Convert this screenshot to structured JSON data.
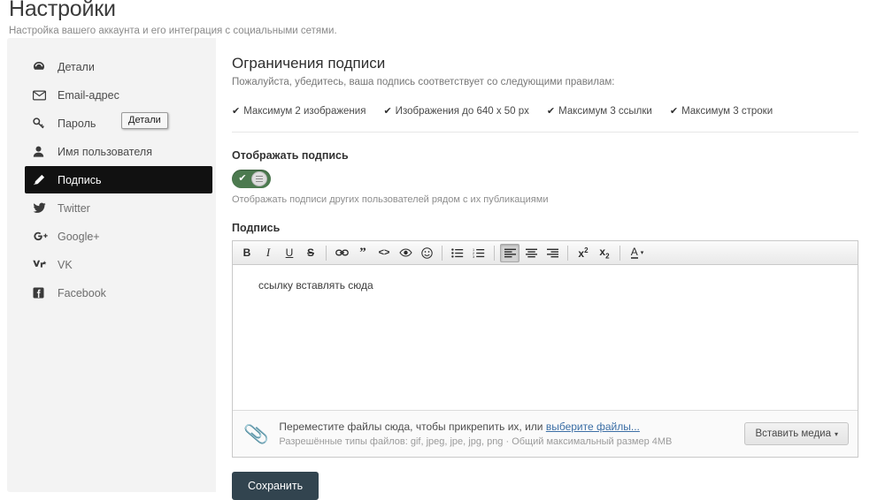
{
  "header": {
    "title": "Настройки",
    "subtitle": "Настройка вашего аккаунта и его интеграция с социальными сетями."
  },
  "tooltip": {
    "text": "Детали"
  },
  "sidebar": {
    "items": [
      {
        "label": "Детали",
        "icon": "dashboard-icon",
        "active": false
      },
      {
        "label": "Email-адрес",
        "icon": "envelope-icon",
        "active": false
      },
      {
        "label": "Пароль",
        "icon": "key-icon",
        "active": false
      },
      {
        "label": "Имя пользователя",
        "icon": "user-icon",
        "active": false
      },
      {
        "label": "Подпись",
        "icon": "pencil-icon",
        "active": true
      },
      {
        "label": "Twitter",
        "icon": "twitter-icon",
        "active": false
      },
      {
        "label": "Google+",
        "icon": "google-plus-icon",
        "active": false
      },
      {
        "label": "VK",
        "icon": "vk-icon",
        "active": false
      },
      {
        "label": "Facebook",
        "icon": "facebook-icon",
        "active": false
      }
    ]
  },
  "main": {
    "limits_title": "Ограничения подписи",
    "limits_subtitle": "Пожалуйста, убедитесь, ваша подпись соответствует со следующими правилам:",
    "rules": [
      "Максимум 2 изображения",
      "Изображения до 640 x 50 px",
      "Максимум 3 ссылки",
      "Максимум 3 строки"
    ],
    "tick_glyph": "✔",
    "toggle_label": "Отображать подпись",
    "toggle_hint": "Отображать подписи других пользователей рядом с их публикациями",
    "toggle_state": "on",
    "signature_label": "Подпись",
    "signature_value": "ссылку вставлять сюда",
    "toolbar": [
      {
        "name": "bold-icon",
        "title": "B",
        "pressed": false
      },
      {
        "name": "italic-icon",
        "title": "I",
        "pressed": false
      },
      {
        "name": "underline-icon",
        "title": "U",
        "pressed": false
      },
      {
        "name": "strikethrough-icon",
        "title": "S",
        "pressed": false
      },
      {
        "name": "link-icon",
        "title": "",
        "pressed": false
      },
      {
        "name": "quote-icon",
        "title": "”",
        "pressed": false
      },
      {
        "name": "code-icon",
        "title": "<>",
        "pressed": false
      },
      {
        "name": "spoiler-eye-icon",
        "title": "",
        "pressed": false
      },
      {
        "name": "smiley-icon",
        "title": "☺",
        "pressed": false
      },
      {
        "name": "bullet-list-icon",
        "title": "",
        "pressed": false
      },
      {
        "name": "numbered-list-icon",
        "title": "",
        "pressed": false
      },
      {
        "name": "align-left-icon",
        "title": "",
        "pressed": true
      },
      {
        "name": "align-center-icon",
        "title": "",
        "pressed": false
      },
      {
        "name": "align-right-icon",
        "title": "",
        "pressed": false
      },
      {
        "name": "superscript-icon",
        "title": "x²",
        "pressed": false
      },
      {
        "name": "subscript-icon",
        "title": "x₂",
        "pressed": false
      },
      {
        "name": "text-color-icon",
        "title": "A",
        "pressed": false
      }
    ],
    "attach": {
      "line1_prefix": "Переместите файлы сюда, чтобы прикрепить их, или ",
      "line1_link": "выберите файлы...",
      "line2": "Разрешённые типы файлов: gif, jpeg, jpe, jpg, png · Общий максимальный размер 4MB",
      "media_button": "Вставить медиа",
      "media_caret": "▾"
    },
    "save_button": "Сохранить"
  },
  "colors": {
    "sidebar_bg": "#f3f3f3",
    "active_item_bg": "#111111",
    "toggle_on": "#4c7a4f",
    "save_bg": "#32444f",
    "link": "#3b6ea5"
  }
}
